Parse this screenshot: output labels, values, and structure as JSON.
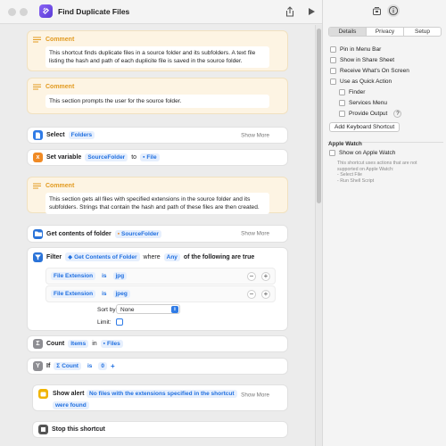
{
  "window": {
    "title": "Find Duplicate Files"
  },
  "colors": {
    "accent": "#1f6fe0",
    "comment": "#e29a1f",
    "select": "#2f7be6",
    "variable": "#f08a24",
    "action_blue": "#2a73d8",
    "script_gray": "#8e8e93",
    "alert_yellow": "#f0b400",
    "stop_gray": "#555555"
  },
  "comments": [
    {
      "label": "Comment",
      "text": "This shortcut finds duplicate files in a source folder and its subfolders. A text file listing the hash and path of each duplicite file is saved in the source folder."
    },
    {
      "label": "Comment",
      "text": "This section prompts the user for the source folder."
    },
    {
      "label": "Comment",
      "text": "This section gets all files with specified extensions in the source folder and its subfolders. Strings that contain the hash and path of these files are then created."
    }
  ],
  "actions": {
    "select": {
      "label": "Select",
      "value": "Folders",
      "more": "Show More"
    },
    "set_variable": {
      "label": "Set variable",
      "var": "SourceFolder",
      "to": "to",
      "value": "File"
    },
    "get_contents": {
      "label": "Get contents of folder",
      "value": "SourceFolder",
      "more": "Show More"
    },
    "filter": {
      "label": "Filter",
      "source": "Get Contents of Folder",
      "where": "where",
      "mode": "Any",
      "suffix": "of the following are true",
      "conditions": [
        {
          "field": "File Extension",
          "op": "is",
          "value": "jpg"
        },
        {
          "field": "File Extension",
          "op": "is",
          "value": "jpeg"
        }
      ],
      "sort_label": "Sort by:",
      "sort_value": "None",
      "limit_label": "Limit:"
    },
    "count": {
      "label": "Count",
      "what": "Items",
      "in": "in",
      "value": "Files"
    },
    "if": {
      "label": "If",
      "var": "Count",
      "op": "is",
      "value": "0"
    },
    "alert": {
      "label": "Show alert",
      "message_1": "No files with the extensions specified in the shortcut",
      "message_2": "were found",
      "more": "Show More"
    },
    "stop": {
      "label": "Stop this shortcut"
    }
  },
  "sidebar": {
    "tabs": [
      "Details",
      "Privacy",
      "Setup"
    ],
    "options": [
      "Pin in Menu Bar",
      "Show in Share Sheet",
      "Receive What's On Screen",
      "Use as Quick Action"
    ],
    "quick_action": [
      "Finder",
      "Services Menu",
      "Provide Output"
    ],
    "help": "?",
    "keyboard_button": "Add Keyboard Shortcut",
    "watch_heading": "Apple Watch",
    "watch_option": "Show on Apple Watch",
    "watch_note": [
      "This shortcut uses actions that are not",
      "supported on Apple Watch:",
      "- Select File",
      "- Run Shell Script"
    ]
  }
}
